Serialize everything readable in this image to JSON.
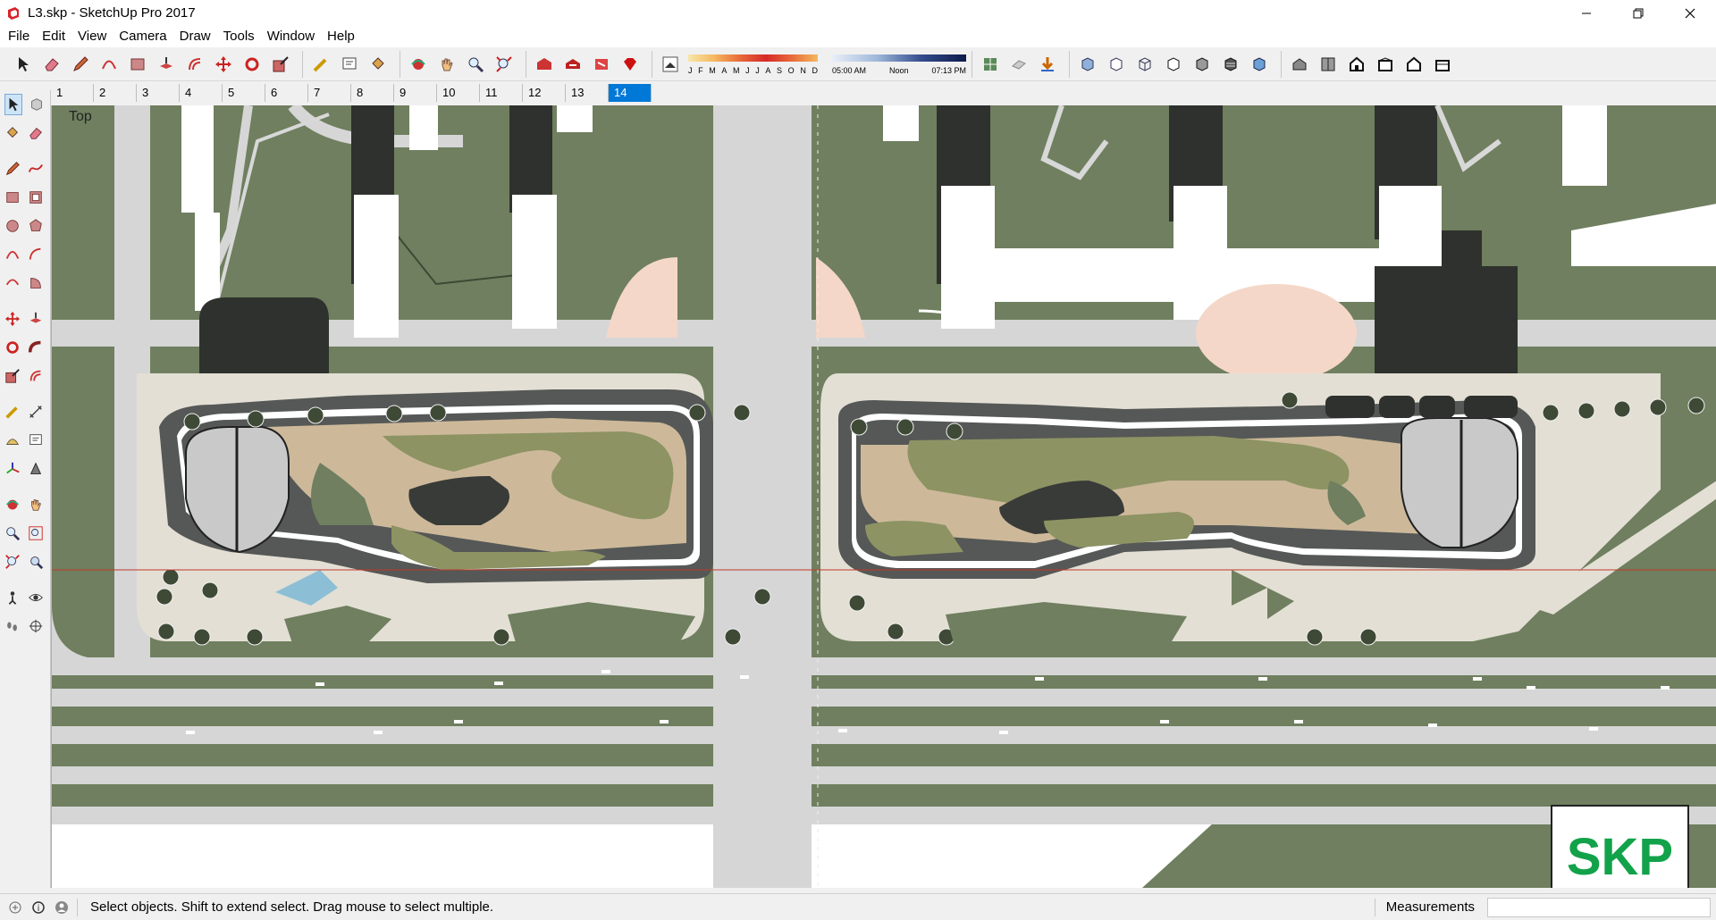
{
  "window": {
    "title": "L3.skp - SketchUp Pro 2017"
  },
  "menu": [
    "File",
    "Edit",
    "View",
    "Camera",
    "Draw",
    "Tools",
    "Window",
    "Help"
  ],
  "shadow_settings": {
    "months": [
      "J",
      "F",
      "M",
      "A",
      "M",
      "J",
      "J",
      "A",
      "S",
      "O",
      "N",
      "D"
    ],
    "time_start": "05:00 AM",
    "time_mid": "Noon",
    "time_end": "07:13 PM"
  },
  "scenes": [
    "1",
    "2",
    "3",
    "4",
    "5",
    "6",
    "7",
    "8",
    "9",
    "10",
    "11",
    "12",
    "13",
    "14"
  ],
  "active_scene": "14",
  "viewport": {
    "view_name": "Top",
    "badge": "SKP"
  },
  "status": {
    "hint": "Select objects. Shift to extend select. Drag mouse to select multiple.",
    "measurements_label": "Measurements"
  },
  "colors": {
    "grass": "#6f7f5f",
    "pavement": "#e3dfd4",
    "road": "#d8d8d8",
    "building_dark": "#2e312d",
    "accent_blue": "#0078d7"
  }
}
